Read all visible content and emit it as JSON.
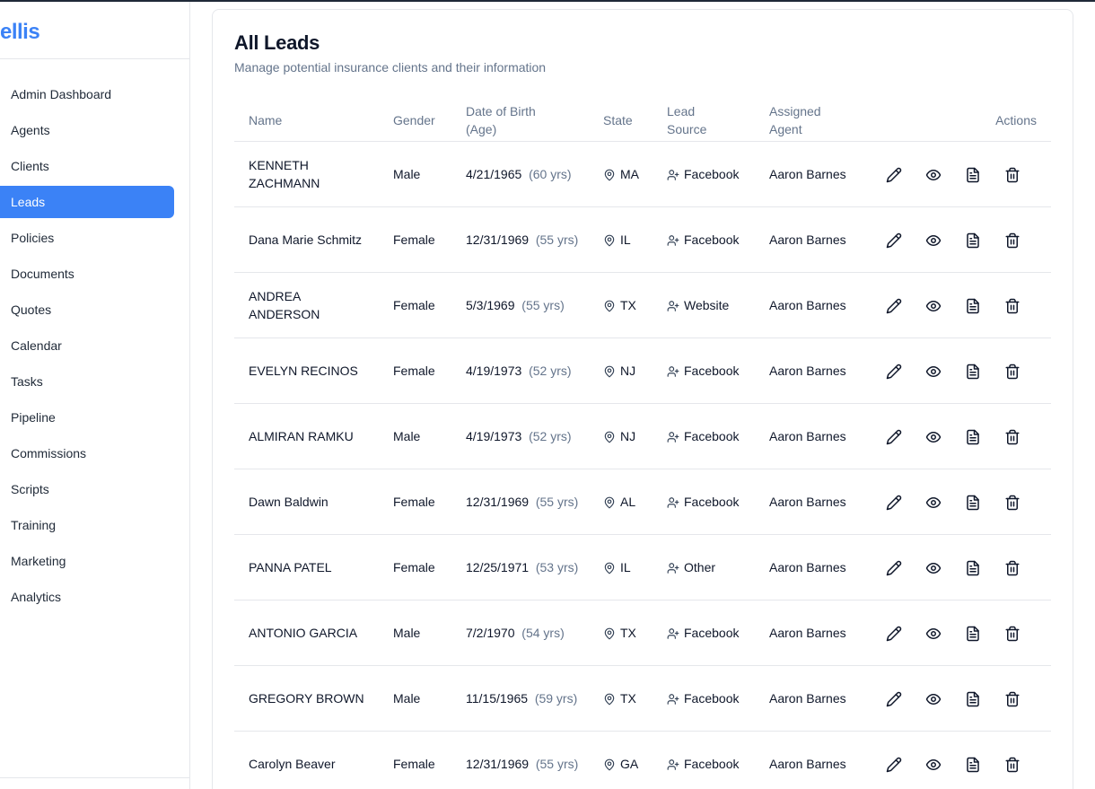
{
  "sidebar": {
    "brand": "ellis",
    "items": [
      {
        "label": "Admin Dashboard",
        "active": false
      },
      {
        "label": "Agents",
        "active": false
      },
      {
        "label": "Clients",
        "active": false
      },
      {
        "label": "Leads",
        "active": true
      },
      {
        "label": "Policies",
        "active": false
      },
      {
        "label": "Documents",
        "active": false
      },
      {
        "label": "Quotes",
        "active": false
      },
      {
        "label": "Calendar",
        "active": false
      },
      {
        "label": "Tasks",
        "active": false
      },
      {
        "label": "Pipeline",
        "active": false
      },
      {
        "label": "Commissions",
        "active": false
      },
      {
        "label": "Scripts",
        "active": false
      },
      {
        "label": "Training",
        "active": false
      },
      {
        "label": "Marketing",
        "active": false
      },
      {
        "label": "Analytics",
        "active": false
      }
    ]
  },
  "page": {
    "title": "All Leads",
    "subtitle": "Manage potential insurance clients and their information"
  },
  "table": {
    "headers": {
      "name": "Name",
      "gender": "Gender",
      "dob_line1": "Date of Birth",
      "dob_line2": "(Age)",
      "state": "State",
      "source_line1": "Lead",
      "source_line2": "Source",
      "agent_line1": "Assigned",
      "agent_line2": "Agent",
      "actions": "Actions"
    },
    "rows": [
      {
        "name": "KENNETH ZACHMANN",
        "gender": "Male",
        "dob": "4/21/1965",
        "age": "(60 yrs)",
        "state": "MA",
        "source": "Facebook",
        "agent": "Aaron Barnes"
      },
      {
        "name": "Dana Marie Schmitz",
        "gender": "Female",
        "dob": "12/31/1969",
        "age": "(55 yrs)",
        "state": "IL",
        "source": "Facebook",
        "agent": "Aaron Barnes"
      },
      {
        "name": "ANDREA ANDERSON",
        "gender": "Female",
        "dob": "5/3/1969",
        "age": "(55 yrs)",
        "state": "TX",
        "source": "Website",
        "agent": "Aaron Barnes"
      },
      {
        "name": "EVELYN RECINOS",
        "gender": "Female",
        "dob": "4/19/1973",
        "age": "(52 yrs)",
        "state": "NJ",
        "source": "Facebook",
        "agent": "Aaron Barnes"
      },
      {
        "name": "ALMIRAN RAMKU",
        "gender": "Male",
        "dob": "4/19/1973",
        "age": "(52 yrs)",
        "state": "NJ",
        "source": "Facebook",
        "agent": "Aaron Barnes"
      },
      {
        "name": "Dawn Baldwin",
        "gender": "Female",
        "dob": "12/31/1969",
        "age": "(55 yrs)",
        "state": "AL",
        "source": "Facebook",
        "agent": "Aaron Barnes"
      },
      {
        "name": "PANNA PATEL",
        "gender": "Female",
        "dob": "12/25/1971",
        "age": "(53 yrs)",
        "state": "IL",
        "source": "Other",
        "agent": "Aaron Barnes"
      },
      {
        "name": "ANTONIO GARCIA",
        "gender": "Male",
        "dob": "7/2/1970",
        "age": "(54 yrs)",
        "state": "TX",
        "source": "Facebook",
        "agent": "Aaron Barnes"
      },
      {
        "name": "GREGORY BROWN",
        "gender": "Male",
        "dob": "11/15/1965",
        "age": "(59 yrs)",
        "state": "TX",
        "source": "Facebook",
        "agent": "Aaron Barnes"
      },
      {
        "name": "Carolyn Beaver",
        "gender": "Female",
        "dob": "12/31/1969",
        "age": "(55 yrs)",
        "state": "GA",
        "source": "Facebook",
        "agent": "Aaron Barnes"
      }
    ]
  },
  "colors": {
    "accent": "#3b82f6",
    "muted_text": "#64748b",
    "border": "#e5e7eb"
  },
  "icons": {
    "state": "map-pin-icon",
    "source": "user-plus-icon",
    "actions": [
      "pencil-icon",
      "eye-icon",
      "document-icon",
      "trash-icon"
    ]
  }
}
